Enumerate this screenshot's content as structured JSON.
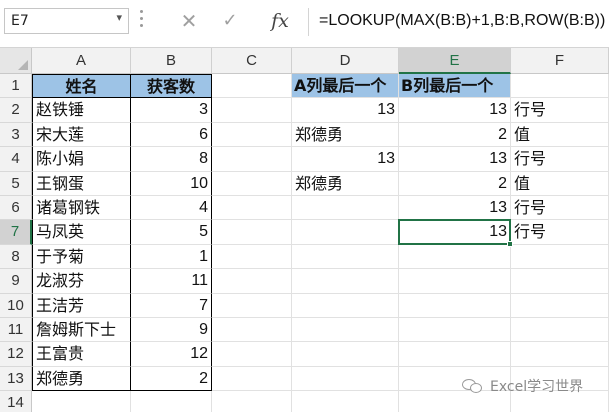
{
  "formula_bar": {
    "name_box": "E7",
    "cancel_glyph": "✕",
    "enter_glyph": "✓",
    "fx_label": "fx",
    "formula": "=LOOKUP(MAX(B:B)+1,B:B,ROW(B:B))"
  },
  "column_headers": [
    "A",
    "B",
    "C",
    "D",
    "E",
    "F"
  ],
  "selected_column": "E",
  "row_headers": [
    "1",
    "2",
    "3",
    "4",
    "5",
    "6",
    "7",
    "8",
    "9",
    "10",
    "11",
    "12",
    "13",
    "14"
  ],
  "selected_row": "7",
  "table": {
    "header_a": "姓名",
    "header_b": "获客数",
    "rows": [
      {
        "name": "赵铁锤",
        "count": "3"
      },
      {
        "name": "宋大莲",
        "count": "6"
      },
      {
        "name": "陈小娟",
        "count": "8"
      },
      {
        "name": "王钢蛋",
        "count": "10"
      },
      {
        "name": "诸葛钢铁",
        "count": "4"
      },
      {
        "name": "马凤英",
        "count": "5"
      },
      {
        "name": "于予菊",
        "count": "1"
      },
      {
        "name": "龙淑芬",
        "count": "11"
      },
      {
        "name": "王洁芳",
        "count": "7"
      },
      {
        "name": "詹姆斯下士",
        "count": "9"
      },
      {
        "name": "王富贵",
        "count": "12"
      },
      {
        "name": "郑德勇",
        "count": "2"
      }
    ]
  },
  "results": {
    "header_d": "A列最后一个",
    "header_e": "B列最后一个",
    "rows": [
      {
        "d": "13",
        "d_type": "num",
        "e": "13",
        "f": "行号"
      },
      {
        "d": "郑德勇",
        "d_type": "txt",
        "e": "2",
        "f": "值"
      },
      {
        "d": "13",
        "d_type": "num",
        "e": "13",
        "f": "行号"
      },
      {
        "d": "郑德勇",
        "d_type": "txt",
        "e": "2",
        "f": "值"
      },
      {
        "d": "",
        "d_type": "num",
        "e": "13",
        "f": "行号"
      },
      {
        "d": "",
        "d_type": "num",
        "e": "13",
        "f": "行号"
      }
    ]
  },
  "watermark": "Excel学习世界",
  "colors": {
    "header_fill": "#9dc3e6",
    "excel_green": "#217346"
  }
}
